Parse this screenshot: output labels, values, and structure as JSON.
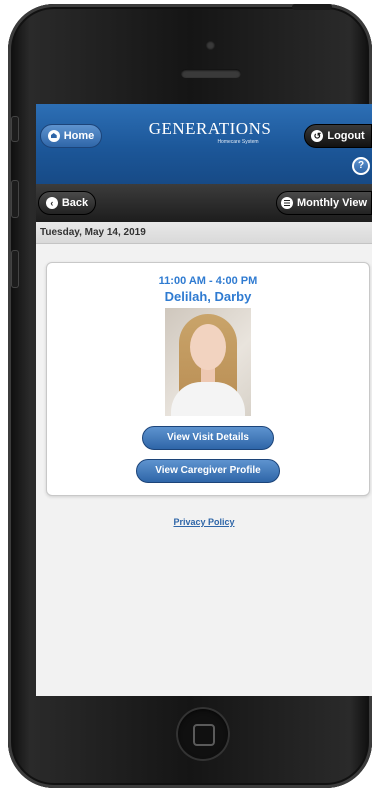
{
  "header": {
    "home_label": "Home",
    "logo_text": "GENERATIONS",
    "logo_subtext": "Homecare System",
    "logout_label": "Logout",
    "help_label": "?"
  },
  "nav": {
    "back_label": "Back",
    "monthly_label": "Monthly View"
  },
  "date_label": "Tuesday, May 14, 2019",
  "visit": {
    "time": "11:00 AM - 4:00 PM",
    "caregiver": "Delilah, Darby",
    "details_button": "View Visit Details",
    "profile_button": "View Caregiver Profile"
  },
  "footer": {
    "privacy_label": "Privacy Policy"
  },
  "colors": {
    "header_blue": "#1c5799",
    "link_blue": "#2f7bd1",
    "nav_dark": "#1d1d1d"
  }
}
